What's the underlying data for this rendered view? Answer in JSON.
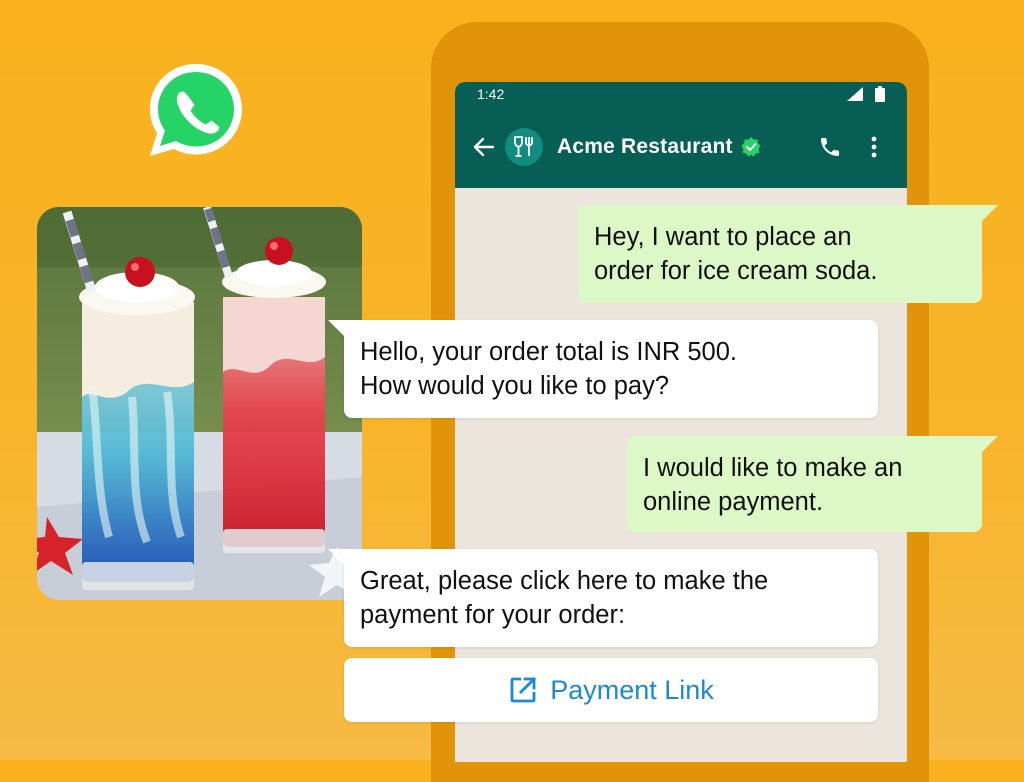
{
  "status_bar": {
    "time": "1:42"
  },
  "chat_header": {
    "contact_name": "Acme Restaurant",
    "verified": true,
    "icons": [
      "back-arrow-icon",
      "restaurant-icon",
      "verified-icon",
      "phone-icon",
      "more-icon"
    ]
  },
  "messages": [
    {
      "direction": "outgoing",
      "lines": [
        "Hey, I want to place an",
        "order for ice cream soda."
      ]
    },
    {
      "direction": "incoming",
      "lines": [
        "Hello, your order total is INR 500.",
        "How would you like to pay?"
      ]
    },
    {
      "direction": "outgoing",
      "lines": [
        "I would like to make an",
        "online payment."
      ]
    },
    {
      "direction": "incoming",
      "lines": [
        "Great, please click here to make the",
        "payment for your order:"
      ]
    }
  ],
  "payment_button": {
    "label": "Payment Link",
    "icon": "external-link-icon"
  },
  "colors": {
    "background": "#f9b21d",
    "phone_frame": "#e1930a",
    "header": "#075e54",
    "outgoing_bubble": "#dcf8c6",
    "incoming_bubble": "#ffffff",
    "link": "#1a8ad2",
    "whatsapp_green": "#25d366"
  }
}
